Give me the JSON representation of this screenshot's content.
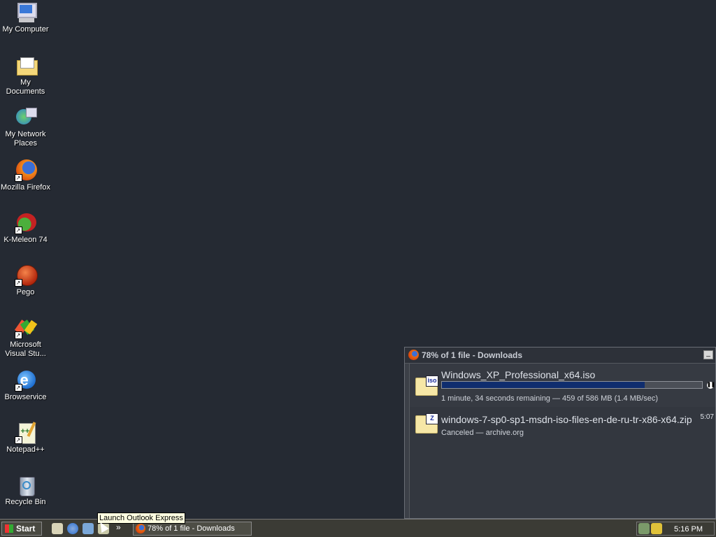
{
  "desktop": {
    "icons": [
      {
        "label": "My Computer",
        "icon": "computer-icon"
      },
      {
        "label": "My Documents",
        "icon": "documents-folder-icon"
      },
      {
        "label": "My Network Places",
        "icon": "network-icon"
      },
      {
        "label": "Mozilla Firefox",
        "icon": "firefox-icon"
      },
      {
        "label": "K-Meleon 74",
        "icon": "kmeleon-icon"
      },
      {
        "label": "Pego",
        "icon": "pego-icon"
      },
      {
        "label": "Microsoft Visual Stu...",
        "icon": "visual-studio-icon"
      },
      {
        "label": "Browservice",
        "icon": "browservice-icon"
      },
      {
        "label": "Notepad++",
        "icon": "notepad-icon"
      },
      {
        "label": "Recycle Bin",
        "icon": "recycle-bin-icon"
      }
    ]
  },
  "downloads": {
    "title": "78% of 1 file - Downloads",
    "items": [
      {
        "filename": "Windows_XP_Professional_x64.iso",
        "badge": "iso",
        "progress_percent": 78,
        "status": "1 minute, 34 seconds remaining — 459 of 586 MB (1.4 MB/sec)"
      },
      {
        "filename": "windows-7-sp0-sp1-msdn-iso-files-en-de-ru-tr-x86-x64.zip",
        "badge": "Z",
        "status": "Canceled — archive.org",
        "time": "5:07"
      }
    ]
  },
  "taskbar": {
    "start_label": "Start",
    "tooltip": "Launch Outlook Express",
    "task_button": "78% of 1 file - Downloads",
    "clock": "5:16 PM",
    "chevron": "»"
  }
}
